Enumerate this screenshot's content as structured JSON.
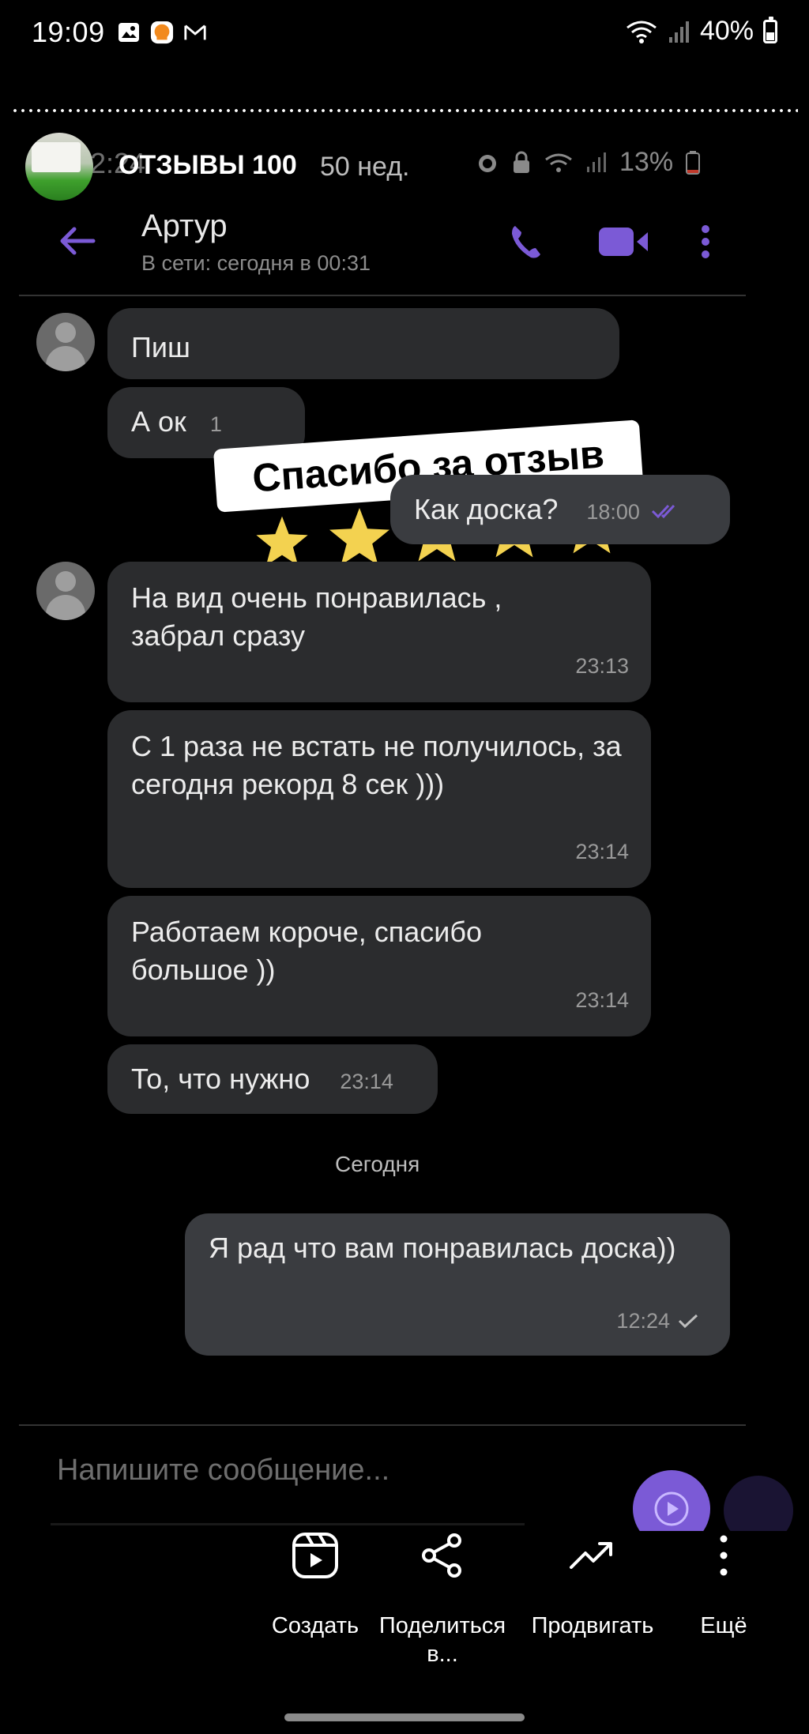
{
  "status_bar": {
    "time": "19:09",
    "battery": "40%",
    "battery_level": 0.4
  },
  "story": {
    "title": "ОТЗЫВЫ 100",
    "age": "50 нед."
  },
  "screenshot": {
    "inner_status": {
      "time": "2:24",
      "battery": "13%"
    },
    "contact": {
      "name": "Артур",
      "status": "В сети: сегодня в 00:31"
    },
    "sticker_text": "Спасибо за отзыв",
    "stars_count": 5,
    "messages": {
      "m1_text": "Пиш",
      "m2_text": "А ок",
      "m2_time": "1",
      "m3_text": "Как доска?",
      "m3_time": "18:00",
      "m4_text": "На вид очень понравилась , забрал сразу",
      "m4_time": "23:13",
      "m5_text": "С 1 раза не встать не получилось, за сегодня рекорд 8 сек )))",
      "m5_time": "23:14",
      "m6_text": "Работаем короче, спасибо большое ))",
      "m6_time": "23:14",
      "m7_text": "То, что нужно",
      "m7_time": "23:14",
      "date_separator": "Сегодня",
      "m8_text": "Я рад что вам понравилась доска))",
      "m8_time": "12:24"
    },
    "input_placeholder": "Напишите сообщение..."
  },
  "actions": {
    "create": "Создать",
    "share": "Поделиться в...",
    "promote": "Продвигать",
    "more": "Ещё"
  },
  "colors": {
    "accent": "#7b5ad6",
    "star": "#f3d250",
    "bubble_in": "#2b2c2e",
    "bubble_out": "#3a3c40"
  }
}
